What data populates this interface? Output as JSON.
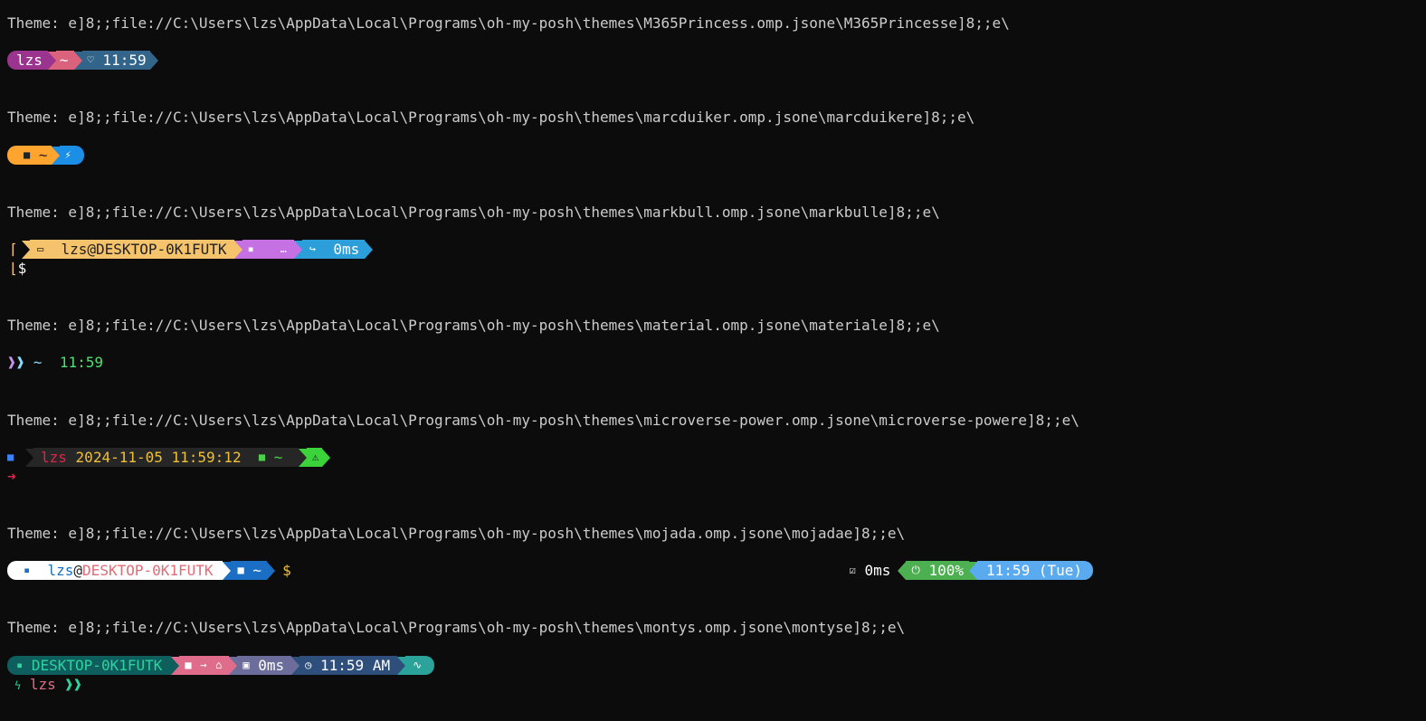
{
  "themes": [
    {
      "line": "Theme: e]8;;file://C:\\Users\\lzs\\AppData\\Local\\Programs\\oh-my-posh\\themes\\M365Princess.omp.jsone\\M365Princesse]8;;e\\",
      "user": "lzs",
      "path": "~",
      "time": "11:59",
      "heart_icon": "heart-icon",
      "colors": {
        "user_bg": "#9a348e",
        "path_bg": "#da627d",
        "time_bg": "#33658a"
      }
    },
    {
      "line": "Theme: e]8;;file://C:\\Users\\lzs\\AppData\\Local\\Programs\\oh-my-posh\\themes\\marcduiker.omp.jsone\\marcduikere]8;;e\\",
      "path": "~",
      "folder_icon": "folder-icon",
      "bolt_icon": "bolt-icon",
      "colors": {
        "path_bg": "#ffa42f",
        "bolt_bg": "#1a8fe5"
      }
    },
    {
      "line": "Theme: e]8;;file://C:\\Users\\lzs\\AppData\\Local\\Programs\\oh-my-posh\\themes\\markbull.omp.jsone\\markbulle]8;;e\\",
      "host": "lzs@DESKTOP-0K1FUTK",
      "path": "…",
      "exec_time": "0ms",
      "prompt_char": "$",
      "colors": {
        "host_bg": "#f4c36b",
        "os_bg": "#c571e4",
        "time_bg": "#2c9fdb"
      }
    },
    {
      "line": "Theme: e]8;;file://C:\\Users\\lzs\\AppData\\Local\\Programs\\oh-my-posh\\themes\\material.omp.jsone\\materiale]8;;e\\",
      "chevrons": "❱❱",
      "path": "~",
      "time": "11:59",
      "colors": {
        "chev1": "#c792ea",
        "chev2": "#89ddff",
        "time": "#4fe06f"
      }
    },
    {
      "line": "Theme: e]8;;file://C:\\Users\\lzs\\AppData\\Local\\Programs\\oh-my-posh\\themes\\microverse-power.omp.jsone\\microverse-powere]8;;e\\",
      "user": "lzs",
      "datetime": "2024-11-05 11:59:12",
      "path": "~",
      "warn_icon": "⚠",
      "arrow": "➜",
      "colors": {
        "user": "#e0244d",
        "datetime": "#f0c034",
        "path": "#4bd24b",
        "warn_bg": "#3ad33a"
      }
    },
    {
      "line": "Theme: e]8;;file://C:\\Users\\lzs\\AppData\\Local\\Programs\\oh-my-posh\\themes\\mojada.omp.jsone\\mojadae]8;;e\\",
      "user": "lzs",
      "at": "@",
      "host": "DESKTOP-0K1FUTK",
      "path": "~",
      "prompt_char": "$",
      "exec_time": "0ms",
      "battery": "100%",
      "time": "11:59 (Tue)",
      "colors": {
        "user_bg": "#ffffff",
        "path_bg": "#1a6fc4",
        "battery_bg": "#4caf50",
        "time_bg": "#5aaaf0"
      }
    },
    {
      "line": "Theme: e]8;;file://C:\\Users\\lzs\\AppData\\Local\\Programs\\oh-my-posh\\themes\\montys.omp.jsone\\montyse]8;;e\\",
      "host": "DESKTOP-0K1FUTK",
      "exec_time": "0ms",
      "time": "11:59 AM",
      "user": "lzs",
      "chevrons": "❱❱",
      "colors": {
        "host_bg": "#0e5e5e",
        "path_bg": "#e06c8c",
        "exec_bg": "#6d6d9c",
        "time_bg": "#2e4f7c",
        "end_bg": "#2ba39b"
      }
    }
  ]
}
